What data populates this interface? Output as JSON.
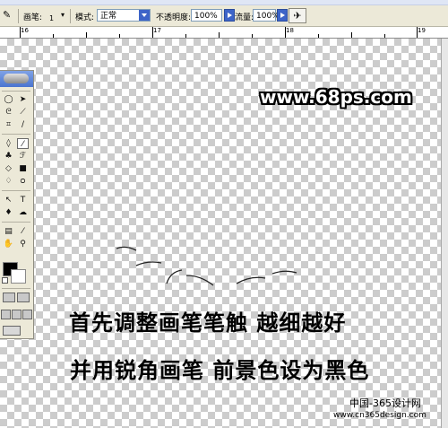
{
  "options_bar": {
    "brush_label": "画笔:",
    "brush_size": "1",
    "mode_label": "模式:",
    "mode_value": "正常",
    "opacity_label": "不透明度:",
    "opacity_value": "100%",
    "flow_label": "流量:",
    "flow_value": "100%"
  },
  "ruler": {
    "ticks": [
      "16",
      "17",
      "18",
      "19"
    ]
  },
  "tools": {
    "icons": [
      "marquee-icon",
      "move-icon",
      "lasso-icon",
      "magic-wand-icon",
      "crop-icon",
      "slice-icon",
      "healing-icon",
      "brush-icon",
      "stamp-icon",
      "history-brush-icon",
      "eraser-icon",
      "gradient-icon",
      "blur-icon",
      "dodge-icon",
      "path-select-icon",
      "type-icon",
      "pen-icon",
      "shape-icon",
      "notes-icon",
      "eyedropper-icon",
      "hand-icon",
      "zoom-icon"
    ],
    "foreground_color": "#000000",
    "background_color": "#ffffff"
  },
  "canvas": {
    "watermark": "www.68ps.com",
    "caption_line1": "首先调整画笔笔触 越细越好",
    "caption_line2": "并用锐角画笔 前景色设为黑色",
    "credit_line1": "中国-365设计网",
    "credit_line2": "www.cn365design.com"
  }
}
